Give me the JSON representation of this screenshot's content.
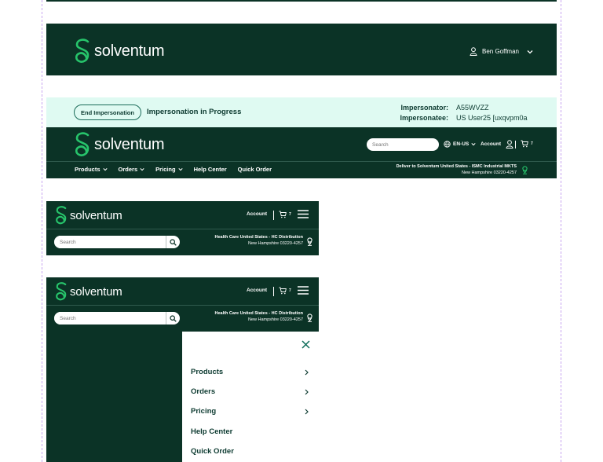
{
  "brand": {
    "name": "solventum"
  },
  "colors": {
    "dark_green": "#0b3326",
    "mint": "#dffaf2",
    "accent": "#27c46b"
  },
  "header_simple": {
    "user_name": "Ben Goffman"
  },
  "impersonation": {
    "end_button": "End Impersonation",
    "status": "Impersonation in Progress",
    "impersonator_label": "Impersonator:",
    "impersonator_value": "A55WVZZ",
    "impersonatee_label": "Impersonatee:",
    "impersonatee_value": "US User25 [uxqvpm0a"
  },
  "desktop": {
    "search_placeholder": "Search",
    "locale": "EN-US",
    "account": "Account",
    "cart_count": "7",
    "nav": [
      {
        "label": "Products",
        "dropdown": true
      },
      {
        "label": "Orders",
        "dropdown": true
      },
      {
        "label": "Pricing",
        "dropdown": true
      },
      {
        "label": "Help Center",
        "dropdown": false
      },
      {
        "label": "Quick Order",
        "dropdown": false
      }
    ],
    "deliver_line1": "Deliver to Solventum United States - ISMC Industrial MKTS",
    "deliver_line2": "New Hampshire 03220-4257"
  },
  "mobile": {
    "account": "Account",
    "cart_count": "7",
    "search_placeholder": "Search",
    "deliver_line1": "Health Care United States - HC Distribution",
    "deliver_line2": "New Hampshire 03220-4257"
  },
  "mobile_menu": {
    "items": [
      {
        "label": "Products",
        "has_children": true
      },
      {
        "label": "Orders",
        "has_children": true
      },
      {
        "label": "Pricing",
        "has_children": true
      },
      {
        "label": "Help Center",
        "has_children": false
      },
      {
        "label": "Quick Order",
        "has_children": false
      }
    ]
  }
}
